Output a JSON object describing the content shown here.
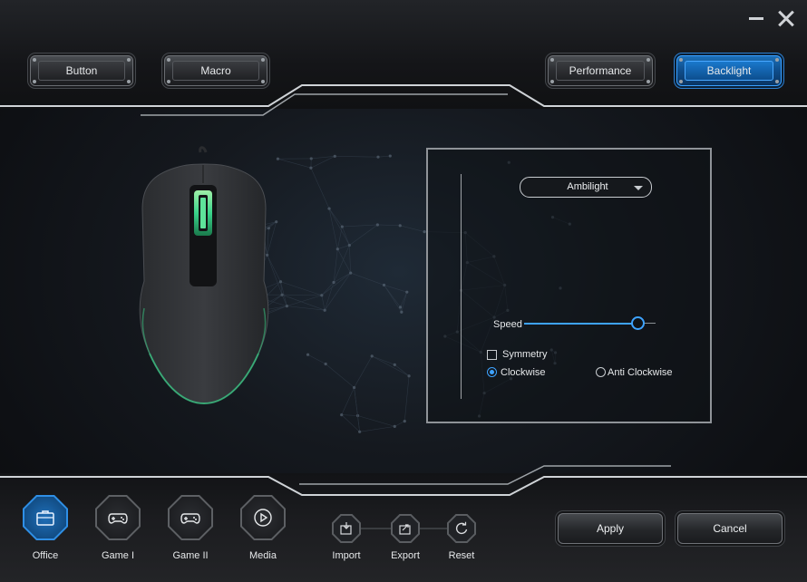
{
  "window": {
    "minimize_icon": "minimize-icon",
    "close_icon": "close-icon"
  },
  "tabs": [
    {
      "label": "Button",
      "active": false
    },
    {
      "label": "Macro",
      "active": false
    },
    {
      "label": "Performance",
      "active": false
    },
    {
      "label": "Backlight",
      "active": true
    }
  ],
  "backlight": {
    "effect": "Ambilight",
    "speed_label": "Speed",
    "speed_value_fraction": 0.86,
    "symmetry_label": "Symmetry",
    "symmetry_checked": false,
    "clockwise_label": "Clockwise",
    "anti_clockwise_label": "Anti Clockwise",
    "direction_selected": "Clockwise"
  },
  "profiles": [
    {
      "label": "Office",
      "icon": "briefcase-icon",
      "active": true
    },
    {
      "label": "Game I",
      "icon": "gamepad-icon",
      "active": false
    },
    {
      "label": "Game II",
      "icon": "gamepad-icon",
      "active": false
    },
    {
      "label": "Media",
      "icon": "play-icon",
      "active": false
    }
  ],
  "file_actions": [
    {
      "label": "Import",
      "icon": "import-icon"
    },
    {
      "label": "Export",
      "icon": "export-icon"
    },
    {
      "label": "Reset",
      "icon": "reset-icon"
    }
  ],
  "actions": {
    "apply_label": "Apply",
    "cancel_label": "Cancel"
  },
  "colors": {
    "accent": "#3ea3ff",
    "active_tab": "#1c6fb8",
    "mouse_glow": "#39d38a"
  }
}
